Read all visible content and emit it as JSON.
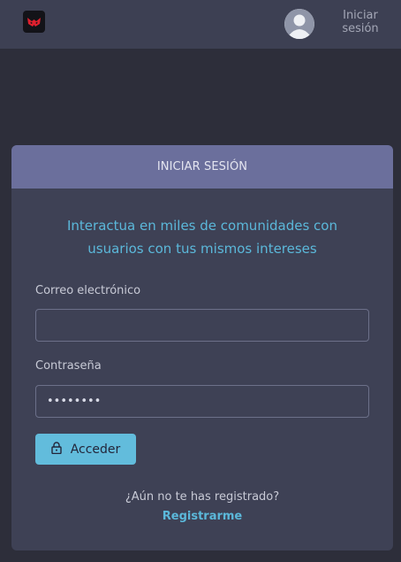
{
  "header": {
    "logo_icon": "red-mask-logo-icon",
    "avatar_icon": "user-avatar-icon",
    "login_line1": "Iniciar",
    "login_line2": "sesión"
  },
  "card": {
    "title": "INICIAR SESIÓN",
    "tagline_line1": "Interactua en miles de comunidades con",
    "tagline_line2": "usuarios con tus mismos intereses",
    "email_label": "Correo electrónico",
    "email_value": "",
    "password_label": "Contraseña",
    "password_value": "••••••••",
    "submit_label": "Acceder",
    "submit_icon": "lock-icon",
    "register_question": "¿Aún no te has registrado?",
    "register_link": "Registrarme"
  },
  "colors": {
    "background": "#2d2e3a",
    "topbar": "#3d4053",
    "card": "#3e4155",
    "card_header": "#6b6f9c",
    "accent": "#5bb8da",
    "logo_red": "#e0202e"
  }
}
